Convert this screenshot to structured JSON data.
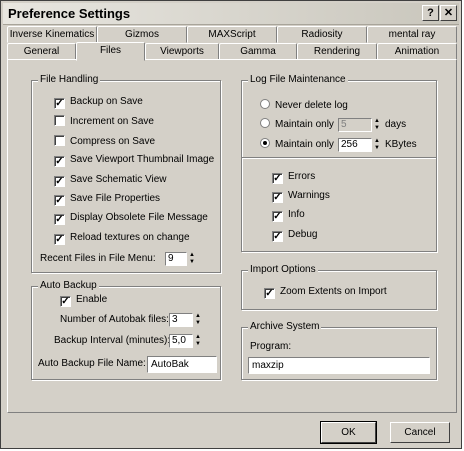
{
  "window": {
    "title": "Preference Settings",
    "help_label": "?",
    "close_label": "✕"
  },
  "tabs_row1": [
    "Inverse Kinematics",
    "Gizmos",
    "MAXScript",
    "Radiosity",
    "mental ray"
  ],
  "tabs_row2": [
    "General",
    "Files",
    "Viewports",
    "Gamma",
    "Rendering",
    "Animation"
  ],
  "file_handling": {
    "label": "File Handling",
    "options": [
      {
        "label": "Backup on Save",
        "checked": true
      },
      {
        "label": "Increment on Save",
        "checked": false
      },
      {
        "label": "Compress on Save",
        "checked": false
      },
      {
        "label": "Save Viewport Thumbnail Image",
        "checked": true
      },
      {
        "label": "Save Schematic View",
        "checked": true
      },
      {
        "label": "Save File Properties",
        "checked": true
      },
      {
        "label": "Display Obsolete File Message",
        "checked": true
      },
      {
        "label": "Reload textures on change",
        "checked": true
      }
    ],
    "recent_label": "Recent Files in File Menu:",
    "recent_value": "9"
  },
  "auto_backup": {
    "label": "Auto Backup",
    "enable_label": "Enable",
    "enable_checked": true,
    "num_files_label": "Number of Autobak files:",
    "num_files_value": "3",
    "interval_label": "Backup Interval (minutes):",
    "interval_value": "5,0",
    "file_name_label": "Auto Backup File Name:",
    "file_name_value": "AutoBak"
  },
  "log_file": {
    "label": "Log File Maintenance",
    "never_delete_label": "Never delete log",
    "maintain_days_label": "Maintain only",
    "maintain_days_value": "5",
    "days_unit": "days",
    "maintain_kb_label": "Maintain only",
    "maintain_kb_value": "256",
    "kb_unit": "KBytes",
    "selected": "kbytes",
    "levels": [
      {
        "label": "Errors",
        "checked": true
      },
      {
        "label": "Warnings",
        "checked": true
      },
      {
        "label": "Info",
        "checked": true
      },
      {
        "label": "Debug",
        "checked": true
      }
    ]
  },
  "import_options": {
    "label": "Import Options",
    "zoom_label": "Zoom Extents on Import",
    "zoom_checked": true
  },
  "archive_system": {
    "label": "Archive System",
    "program_label": "Program:",
    "program_value": "maxzip"
  },
  "buttons": {
    "ok": "OK",
    "cancel": "Cancel"
  }
}
